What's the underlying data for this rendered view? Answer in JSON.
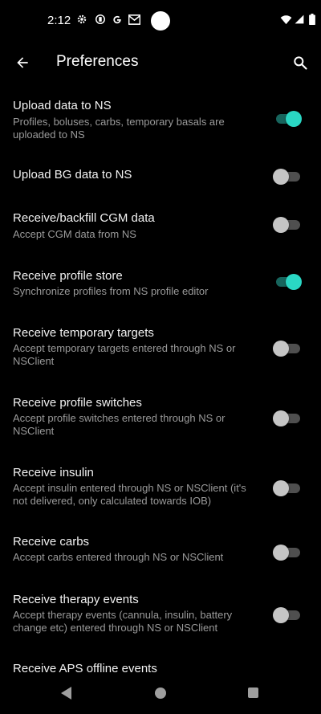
{
  "status": {
    "time": "2:12",
    "icons": [
      "gear-icon",
      "vpn-key-icon",
      "google-icon",
      "gmail-icon",
      "wifi-icon",
      "signal-icon",
      "battery-icon"
    ]
  },
  "toolbar": {
    "title": "Preferences",
    "back_icon": "arrow-back-icon",
    "search_icon": "search-icon"
  },
  "colors": {
    "accent": "#2ad7c4",
    "accent_track": "#17655d",
    "background": "#000000"
  },
  "settings": [
    {
      "title": "Upload data to NS",
      "summary": "Profiles, boluses, carbs, temporary basals are uploaded to NS",
      "enabled": true
    },
    {
      "title": "Upload BG data to NS",
      "summary": "",
      "enabled": false
    },
    {
      "title": "Receive/backfill CGM data",
      "summary": "Accept CGM data from NS",
      "enabled": false
    },
    {
      "title": "Receive profile store",
      "summary": "Synchronize profiles from NS profile editor",
      "enabled": true
    },
    {
      "title": "Receive temporary targets",
      "summary": "Accept temporary targets entered through NS or NSClient",
      "enabled": false
    },
    {
      "title": "Receive profile switches",
      "summary": "Accept profile switches entered through NS or NSClient",
      "enabled": false
    },
    {
      "title": "Receive insulin",
      "summary": "Accept insulin entered through NS or NSClient (it's not delivered, only calculated towards IOB)",
      "enabled": false
    },
    {
      "title": "Receive carbs",
      "summary": "Accept carbs entered through NS or NSClient",
      "enabled": false
    },
    {
      "title": "Receive therapy events",
      "summary": "Accept therapy events (cannula, insulin, battery change etc) entered through NS or NSClient",
      "enabled": false
    },
    {
      "title": "Receive APS offline events",
      "summary": "",
      "enabled": false
    }
  ]
}
